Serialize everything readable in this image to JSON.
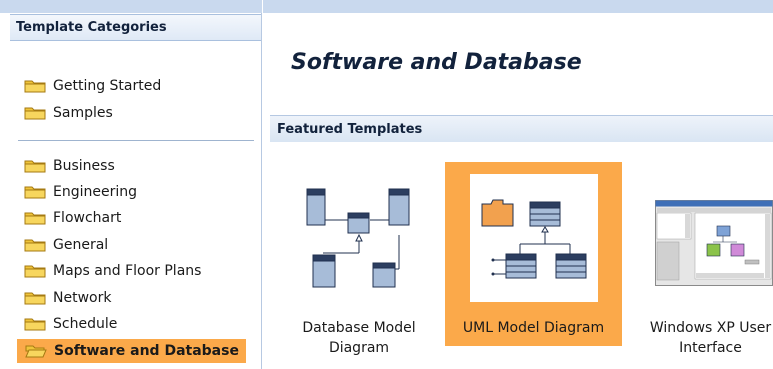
{
  "sidebar": {
    "title": "Template Categories",
    "items": [
      {
        "label": "Getting Started"
      },
      {
        "label": "Samples"
      },
      {
        "label": "Business"
      },
      {
        "label": "Engineering"
      },
      {
        "label": "Flowchart"
      },
      {
        "label": "General"
      },
      {
        "label": "Maps and Floor Plans"
      },
      {
        "label": "Network"
      },
      {
        "label": "Schedule"
      },
      {
        "label": "Software and Database",
        "selected": true
      }
    ]
  },
  "main": {
    "title": "Software and Database",
    "section_title": "Featured Templates",
    "templates": [
      {
        "label_line1": "Database Model",
        "label_line2": "Diagram",
        "icon": "database-diagram-icon"
      },
      {
        "label_line1": "UML Model Diagram",
        "label_line2": "",
        "icon": "uml-diagram-icon",
        "selected": true
      },
      {
        "label_line1": "Windows XP User",
        "label_line2": "Interface",
        "icon": "windows-xp-ui-icon"
      }
    ]
  },
  "colors": {
    "selection": "#fba94a",
    "header_text": "#12223c",
    "panel_border": "#b7c9e2",
    "folder_yellow": "#f0c43a"
  }
}
